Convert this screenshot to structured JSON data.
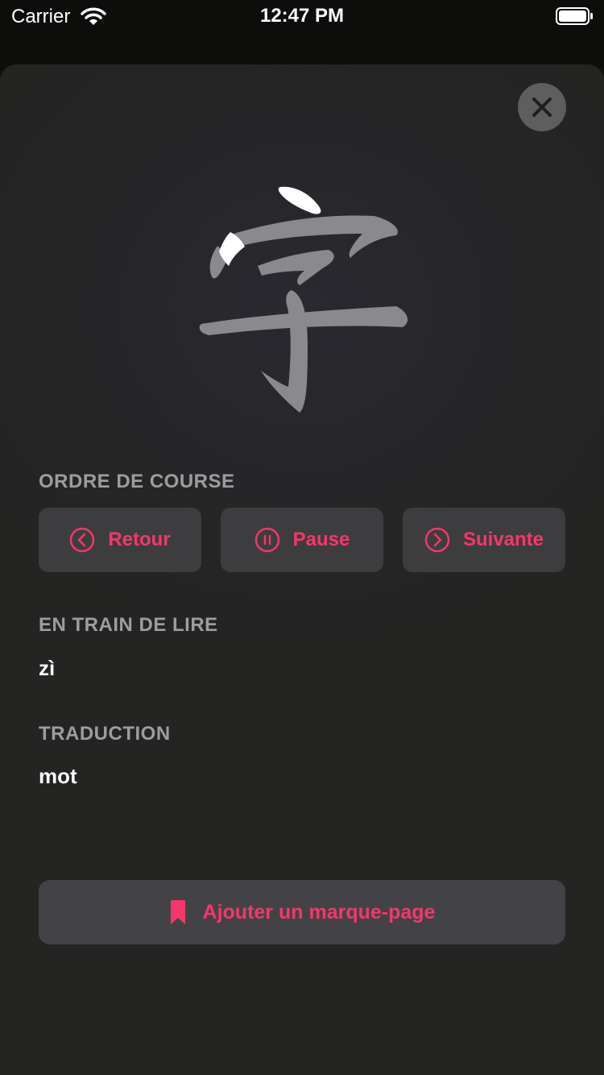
{
  "status_bar": {
    "carrier": "Carrier",
    "time": "12:47 PM"
  },
  "character": {
    "glyph": "字",
    "stroke_color": "#8a8a8e",
    "active_stroke_color": "#ffffff"
  },
  "stroke_order": {
    "label": "ORDRE DE COURSE",
    "buttons": [
      {
        "label": "Retour",
        "icon": "chevron-left-circle-icon"
      },
      {
        "label": "Pause",
        "icon": "pause-circle-icon"
      },
      {
        "label": "Suivante",
        "icon": "chevron-right-circle-icon"
      }
    ]
  },
  "now_reading": {
    "label": "EN TRAIN DE LIRE",
    "value": "zì"
  },
  "translation": {
    "label": "TRADUCTION",
    "value": "mot"
  },
  "bookmark": {
    "label": "Ajouter un marque-page",
    "icon": "bookmark-icon"
  },
  "colors": {
    "accent": "#f4376a",
    "sheet": "#262628",
    "button": "#3d3d3f"
  }
}
